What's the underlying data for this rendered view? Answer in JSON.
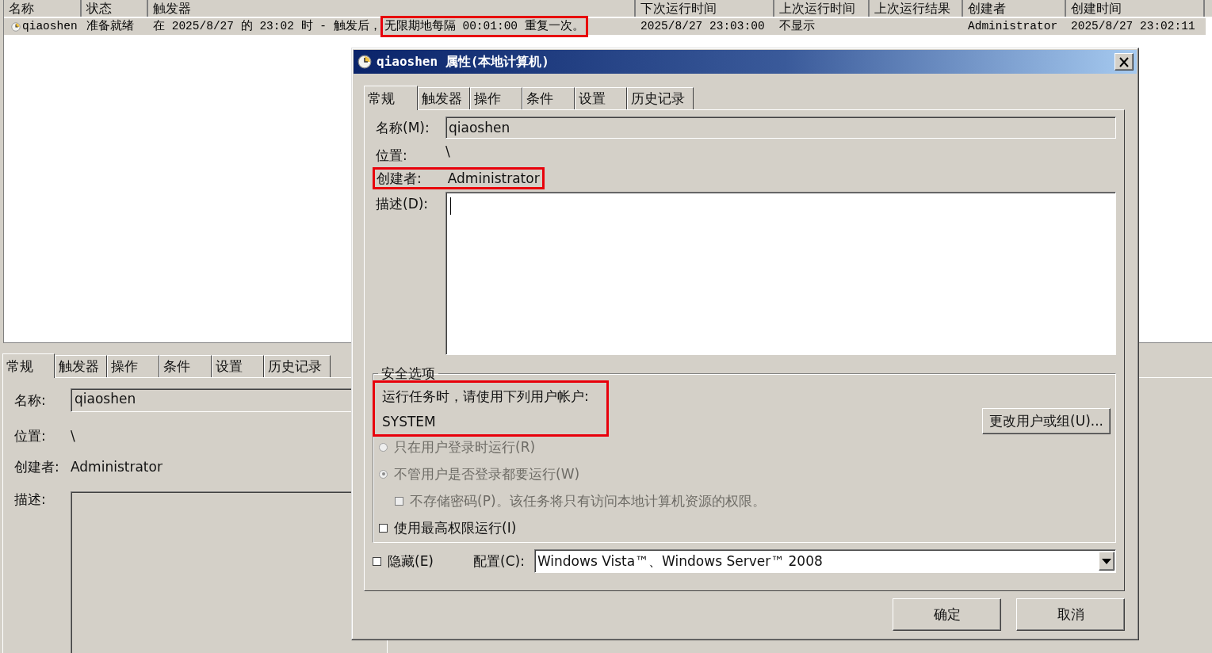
{
  "task_list": {
    "columns": [
      "名称",
      "状态",
      "触发器",
      "下次运行时间",
      "上次运行时间",
      "上次运行结果",
      "创建者",
      "创建时间"
    ],
    "rows": [
      {
        "selected": true,
        "name": "qiaoshen",
        "status": "准备就绪",
        "trigger": [
          {
            "text": "在 2025/8/27 的 23:02 时 - 触发后，",
            "highlighted": false
          },
          {
            "text": "无限期地每隔 00:01:00 重复一次。",
            "highlighted": true
          }
        ],
        "next_run": "2025/8/27 23:03:00",
        "last_run": "不显示",
        "author": "Administrator",
        "created": "2025/8/27 23:02:11"
      }
    ]
  },
  "detail_pane": {
    "tabs": [
      {
        "label": "常规",
        "selected": true
      },
      {
        "label": "触发器",
        "selected": false
      },
      {
        "label": "操作",
        "selected": false
      },
      {
        "label": "条件",
        "selected": false
      },
      {
        "label": "设置",
        "selected": false
      },
      {
        "label": "历史记录",
        "selected": false
      }
    ],
    "name": {
      "label": "名称:",
      "value": "qiaoshen"
    },
    "location": {
      "label": "位置:",
      "value": "\\"
    },
    "author": {
      "label": "创建者:",
      "value": "Administrator"
    },
    "description": {
      "label": "描述:"
    }
  },
  "dialog": {
    "title": "qiaoshen 属性(本地计算机)",
    "tabs": [
      {
        "label": "常规",
        "selected": true
      },
      {
        "label": "触发器",
        "selected": false
      },
      {
        "label": "操作",
        "selected": false
      },
      {
        "label": "条件",
        "selected": false
      },
      {
        "label": "设置",
        "selected": false
      },
      {
        "label": "历史记录",
        "selected": false
      }
    ],
    "name": {
      "label": "名称(M):",
      "value": "qiaoshen"
    },
    "location": {
      "label": "位置:",
      "value": "\\"
    },
    "author": {
      "label": "创建者:",
      "value": "Administrator",
      "highlighted": true
    },
    "description": {
      "label": "描述(D):",
      "focused": true
    },
    "security": {
      "title": "安全选项",
      "account_prompt": "运行任务时，请使用下列用户帐户:",
      "account": "SYSTEM",
      "highlighted": true,
      "change_button": {
        "label": "更改用户或组(U)..."
      },
      "options": [
        {
          "kind": "radio",
          "label": "只在用户登录时运行(R)",
          "selected": false,
          "disabled": true
        },
        {
          "kind": "radio",
          "label": "不管用户是否登录都要运行(W)",
          "selected": true,
          "disabled": true,
          "children": [
            {
              "kind": "checkbox",
              "label": "不存储密码(P)。该任务将只有访问本地计算机资源的权限。",
              "checked": false,
              "disabled": true
            }
          ]
        },
        {
          "kind": "checkbox",
          "label": "使用最高权限运行(I)",
          "checked": false,
          "disabled": false
        }
      ]
    },
    "hidden": {
      "label": "隐藏(E)",
      "checked": false
    },
    "configure": {
      "label": "配置(C):",
      "value": "Windows Vista™、Windows Server™ 2008"
    },
    "buttons": [
      {
        "label": "确定"
      },
      {
        "label": "取消"
      }
    ]
  }
}
